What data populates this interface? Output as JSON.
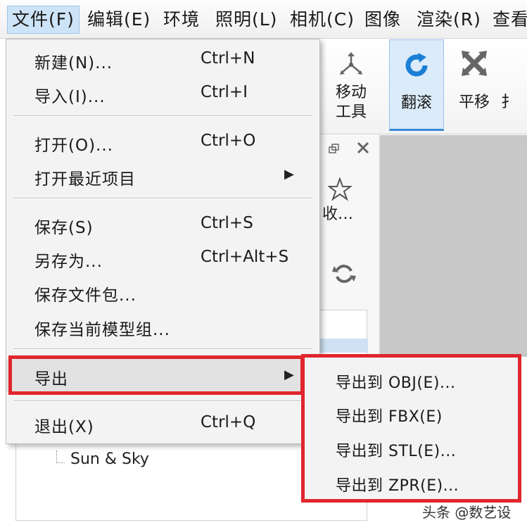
{
  "menubar": {
    "items": [
      {
        "label": "文件(F)"
      },
      {
        "label": "编辑(E)"
      },
      {
        "label": "环境"
      },
      {
        "label": "照明(L)"
      },
      {
        "label": "相机(C)"
      },
      {
        "label": "图像"
      },
      {
        "label": "渲染(R)"
      },
      {
        "label": "查看"
      }
    ]
  },
  "toolbar": {
    "move_tool_line1": "移动",
    "move_tool_line2": "工具",
    "tumble_label": "翻滚",
    "pan_label": "平移",
    "partial_label": "扌"
  },
  "side_panel": {
    "favorites_label": "收…"
  },
  "scene_tree": {
    "item": "Sun & Sky"
  },
  "file_menu": {
    "items": [
      {
        "label": "新建(N)...",
        "shortcut": "Ctrl+N"
      },
      {
        "label": "导入(I)...",
        "shortcut": "Ctrl+I"
      },
      {
        "label": "打开(O)...",
        "shortcut": "Ctrl+O"
      },
      {
        "label": "打开最近项目",
        "shortcut": ""
      },
      {
        "label": "保存(S)",
        "shortcut": "Ctrl+S"
      },
      {
        "label": "另存为...",
        "shortcut": "Ctrl+Alt+S"
      },
      {
        "label": "保存文件包...",
        "shortcut": ""
      },
      {
        "label": "保存当前模型组...",
        "shortcut": ""
      },
      {
        "label": "导出",
        "shortcut": ""
      },
      {
        "label": "退出(X)",
        "shortcut": "Ctrl+Q"
      }
    ]
  },
  "export_submenu": {
    "items": [
      {
        "label": "导出到 OBJ(E)..."
      },
      {
        "label": "导出到 FBX(E)"
      },
      {
        "label": "导出到 STL(E)..."
      },
      {
        "label": "导出到 ZPR(E)..."
      }
    ]
  },
  "watermark": "头条 @数艺设",
  "colors": {
    "highlight": "#e0262e",
    "accent_blue": "#1c7fd6",
    "menu_bg": "#f3f3f3"
  }
}
